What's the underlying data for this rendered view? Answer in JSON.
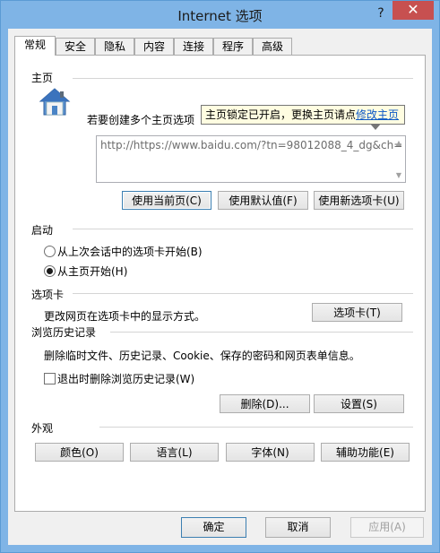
{
  "window": {
    "title": "Internet 选项",
    "help_glyph": "?",
    "close_glyph": "✕"
  },
  "tabs": [
    "常规",
    "安全",
    "隐私",
    "内容",
    "连接",
    "程序",
    "高级"
  ],
  "home": {
    "section_label": "主页",
    "description": "若要创建多个主页选项",
    "url": "http://https://www.baidu.com/?tn=98012088_4_dg&ch=",
    "tooltip_text": "主页锁定已开启，更换主页请点",
    "tooltip_link": "修改主页",
    "buttons": [
      "使用当前页(C)",
      "使用默认值(F)",
      "使用新选项卡(U)"
    ]
  },
  "startup": {
    "section_label": "启动",
    "option1": "从上次会话中的选项卡开始(B)",
    "option2": "从主页开始(H)",
    "selected": 2
  },
  "tabs_section": {
    "section_label": "选项卡",
    "description": "更改网页在选项卡中的显示方式。",
    "button": "选项卡(T)"
  },
  "history": {
    "section_label": "浏览历史记录",
    "description": "删除临时文件、历史记录、Cookie、保存的密码和网页表单信息。",
    "checkbox_label": "退出时删除浏览历史记录(W)",
    "checked": false,
    "delete_button": "删除(D)...",
    "settings_button": "设置(S)"
  },
  "appearance": {
    "section_label": "外观",
    "buttons": [
      "颜色(O)",
      "语言(L)",
      "字体(N)",
      "辅助功能(E)"
    ]
  },
  "footer": {
    "ok": "确定",
    "cancel": "取消",
    "apply": "应用(A)"
  },
  "colors": {
    "titlebar": "#7fb4e6",
    "close_button": "#c75050",
    "tooltip_bg": "#fffde1",
    "link": "#0b57c6"
  }
}
